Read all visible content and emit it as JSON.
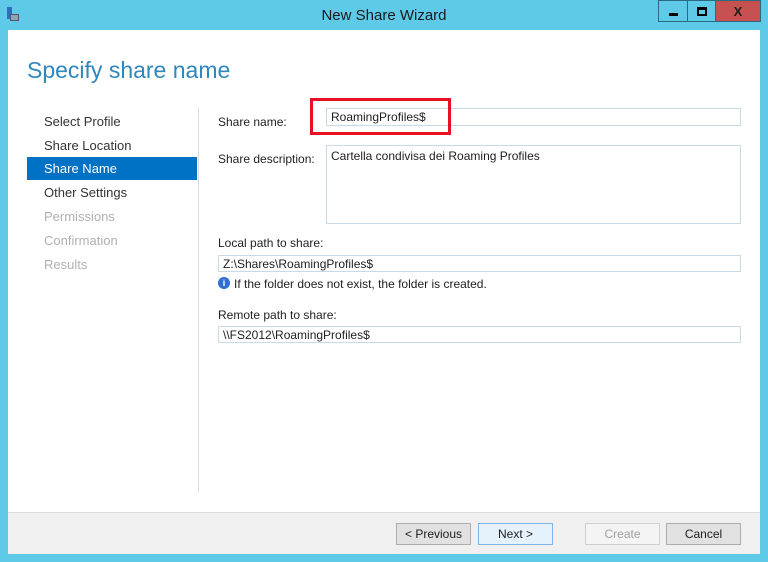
{
  "window": {
    "title": "New Share Wizard",
    "minimize": "_",
    "maximize": "□",
    "close": "X"
  },
  "heading": "Specify share name",
  "nav": [
    {
      "label": "Select Profile",
      "state": "done"
    },
    {
      "label": "Share Location",
      "state": "done"
    },
    {
      "label": "Share Name",
      "state": "selected"
    },
    {
      "label": "Other Settings",
      "state": "done"
    },
    {
      "label": "Permissions",
      "state": "disabled"
    },
    {
      "label": "Confirmation",
      "state": "disabled"
    },
    {
      "label": "Results",
      "state": "disabled"
    }
  ],
  "form": {
    "share_name_label": "Share name:",
    "share_name_value": "RoamingProfiles$",
    "share_description_label": "Share description:",
    "share_description_value": "Cartella condivisa dei Roaming Profiles",
    "local_path_label": "Local path to share:",
    "local_path_value": "Z:\\Shares\\RoamingProfiles$",
    "info_text": "If the folder does not exist, the folder is created.",
    "remote_path_label": "Remote path to share:",
    "remote_path_value": "\\\\FS2012\\RoamingProfiles$"
  },
  "buttons": {
    "previous": "< Previous",
    "next": "Next >",
    "create": "Create",
    "cancel": "Cancel"
  },
  "colors": {
    "accent": "#0072c6",
    "highlight": "#e81123"
  }
}
